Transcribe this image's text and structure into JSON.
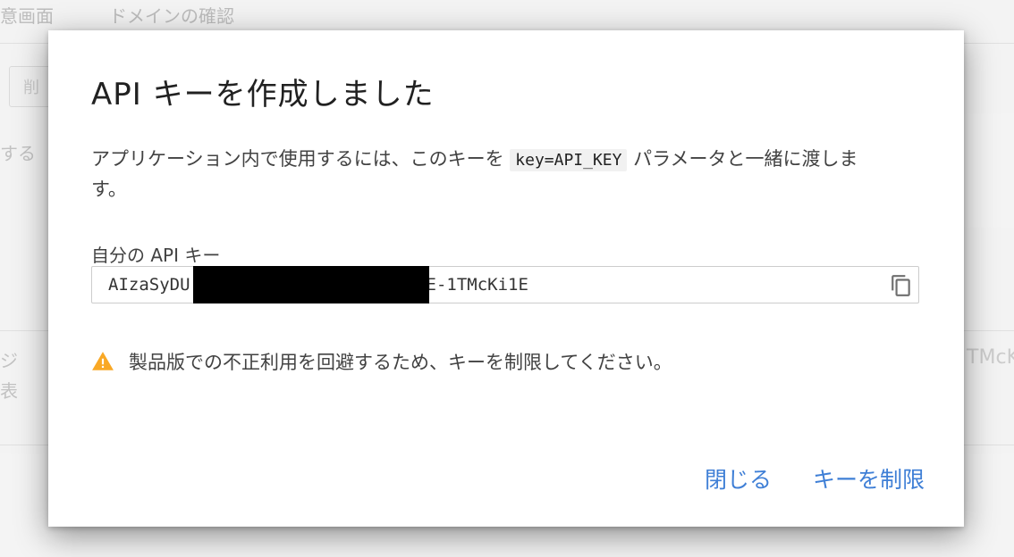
{
  "background": {
    "tabs": [
      "意画面",
      "ドメインの確認"
    ],
    "delete_button": "削",
    "text_fragment": "する",
    "row_fragments": [
      "ジ",
      "表"
    ],
    "right_fragment": "TMcK"
  },
  "dialog": {
    "title": "API キーを作成しました",
    "description": {
      "before": "アプリケーション内で使用するには、このキーを",
      "param": "key=API_KEY",
      "after": "パラメータと一緒に渡します。"
    },
    "key_label": "自分の API キー",
    "key_value_visible_start": "AIzaSyDU",
    "key_value_visible_end": "E-1TMcKi1E",
    "copy_icon": "copy-icon",
    "warning_icon": "warning-icon",
    "warning_text": "製品版での不正利用を回避するため、キーを制限してください。",
    "buttons": {
      "close": "閉じる",
      "restrict": "キーを制限"
    }
  },
  "colors": {
    "accent": "#3f7fd6",
    "warning": "#f9a825",
    "overlay": "#e6e6e6"
  }
}
